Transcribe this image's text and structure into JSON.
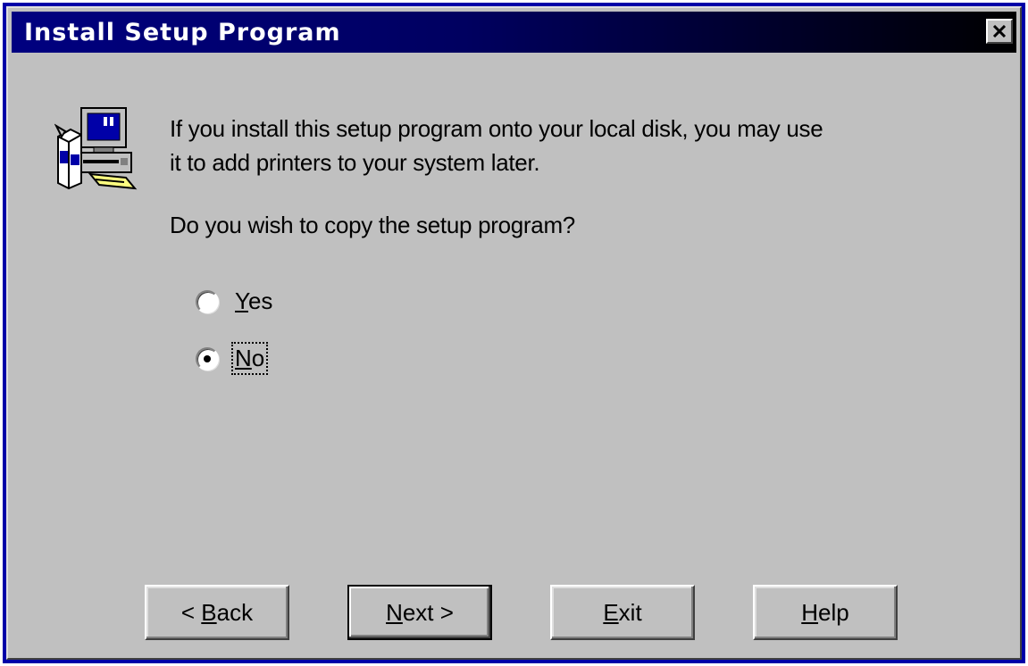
{
  "window": {
    "title": "Install Setup Program",
    "close_glyph": "×"
  },
  "icon": {
    "name": "computer-setup-icon"
  },
  "message": {
    "line1": "If you install this setup program onto your local disk, you may use",
    "line2": "it to add printers to your system later."
  },
  "question": "Do you wish to copy the setup program?",
  "options": [
    {
      "key": "Y",
      "rest": "es",
      "selected": false
    },
    {
      "key": "N",
      "rest": "o",
      "selected": true
    }
  ],
  "buttons": {
    "back": {
      "prefix": "< ",
      "key": "B",
      "rest": "ack"
    },
    "next": {
      "prefix": "",
      "key": "N",
      "rest": "ext >"
    },
    "exit": {
      "prefix": "",
      "key": "E",
      "rest": "xit"
    },
    "help": {
      "prefix": "",
      "key": "H",
      "rest": "elp"
    }
  },
  "colors": {
    "titlebar": "#000080",
    "face": "#c0c0c0"
  }
}
